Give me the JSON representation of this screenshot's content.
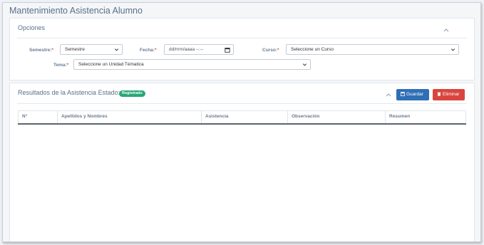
{
  "page": {
    "title": "Mantenimiento Asistencia Alumno"
  },
  "options": {
    "title": "Opciones",
    "semestre": {
      "label": "Semestre:",
      "value": "Semestre"
    },
    "fecha": {
      "label": "Fecha:",
      "placeholder": "dd/mm/aaaa --:--"
    },
    "curso": {
      "label": "Curso:",
      "value": "Seleccione un Curso"
    },
    "tema": {
      "label": "Tema:",
      "value": "Seleccione un Unidad Tématica"
    },
    "required_mark": "*"
  },
  "results": {
    "title": "Resultados de la Asistencia Estado:",
    "status_badge": "Registrado",
    "save_label": "Guardar",
    "delete_label": "Eliminar",
    "columns": [
      "N°",
      "Apellidos y Nombres",
      "Asistencia",
      "Observación",
      "Resumen"
    ]
  },
  "colors": {
    "primary": "#2f6fb5",
    "danger": "#d9453e",
    "success": "#27a776"
  },
  "icons": {
    "collapse": "chevron-up-icon",
    "save": "floppy-disk-icon",
    "delete": "trash-icon",
    "calendar": "calendar-icon",
    "dropdown": "chevron-down-icon"
  }
}
